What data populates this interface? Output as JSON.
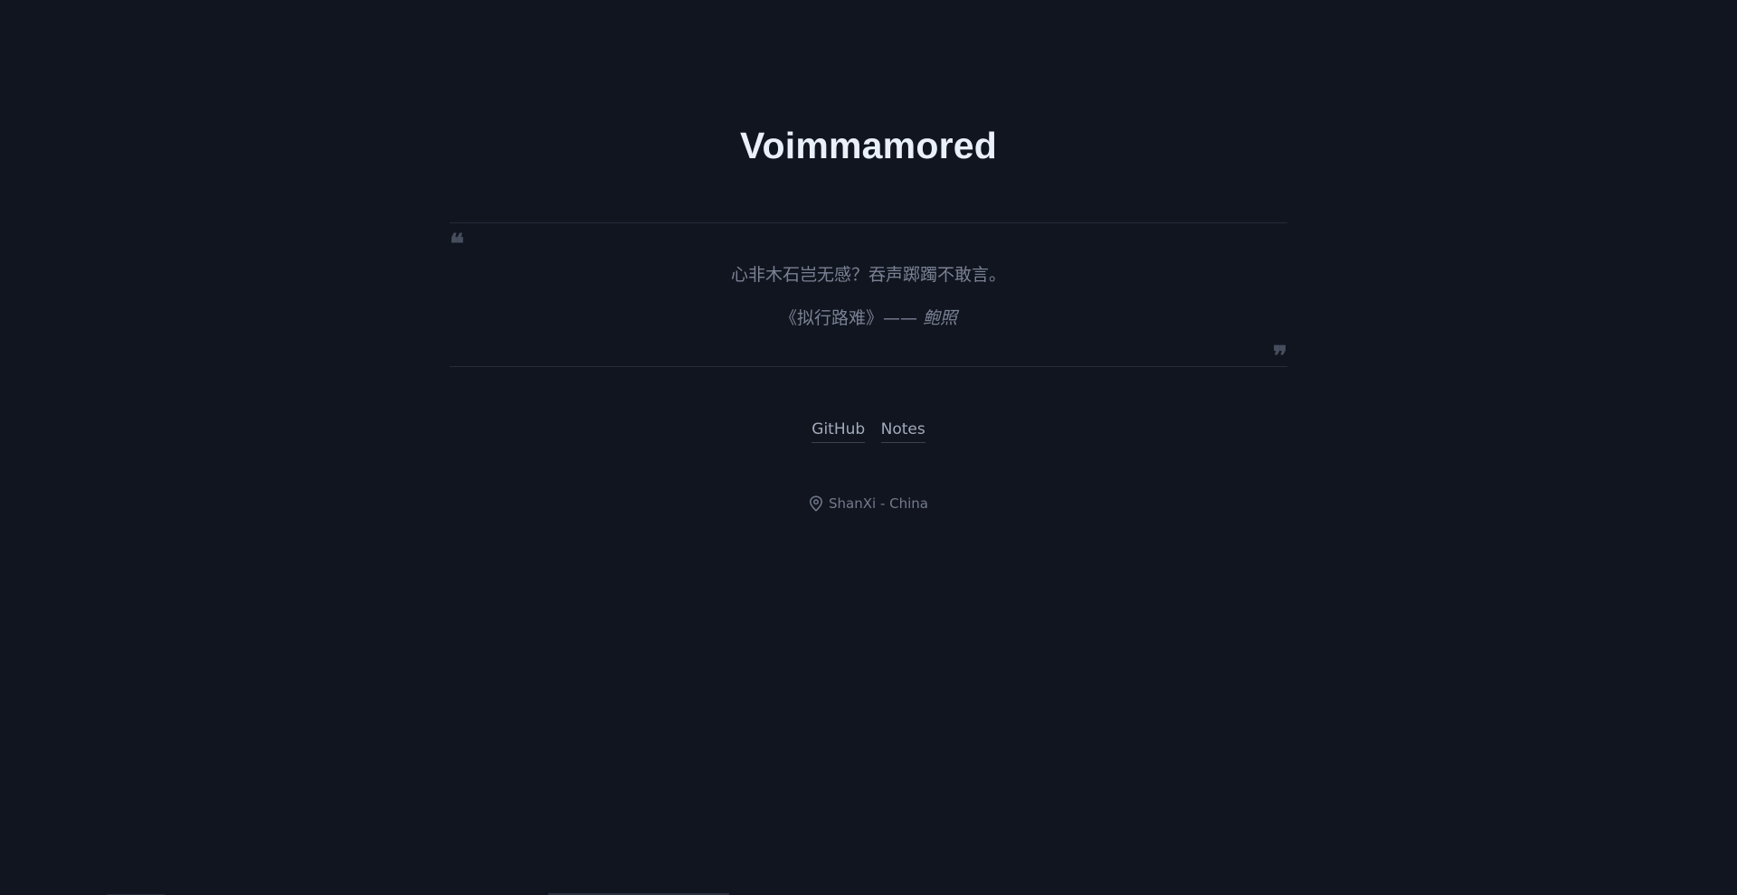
{
  "header": {
    "title": "Voimmamored"
  },
  "quote": {
    "open_mark": "❝",
    "close_mark": "❞",
    "text": "心非木石岂无感？吞声踯躅不敢言。",
    "source_prefix": "《拟行路难》—— ",
    "author": "鲍照"
  },
  "links": [
    {
      "label": "GitHub"
    },
    {
      "label": "Notes"
    }
  ],
  "location": {
    "icon": "map-pin-icon",
    "text": "ShanXi - China"
  },
  "colors": {
    "background": "#111520",
    "title": "#eaf0fa",
    "quote_text": "#7a8193",
    "link": "#a3aabb",
    "divider": "#262b38"
  }
}
